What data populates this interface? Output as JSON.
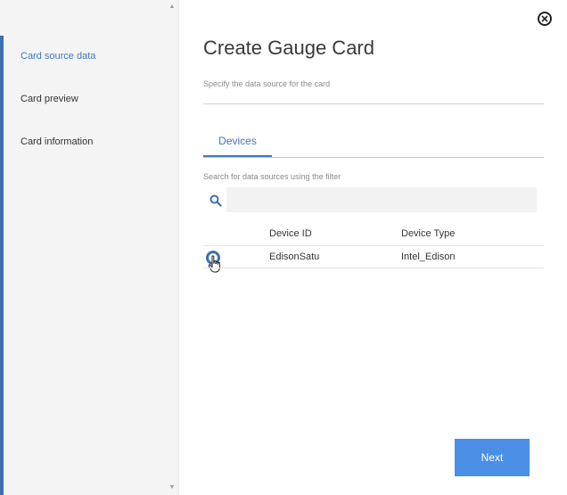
{
  "sidebar": {
    "items": [
      {
        "label": "Card source data",
        "active": true
      },
      {
        "label": "Card preview",
        "active": false
      },
      {
        "label": "Card information",
        "active": false
      }
    ]
  },
  "dialog": {
    "title": "Create Gauge Card",
    "subtitle": "Specify the data source for the card",
    "close_icon": "close-circle-icon"
  },
  "tabs": [
    {
      "label": "Devices",
      "active": true
    }
  ],
  "filter": {
    "hint": "Search for data sources using the filter",
    "search_icon": "search-icon",
    "value": "",
    "placeholder": ""
  },
  "table": {
    "columns": [
      "Device ID",
      "Device Type"
    ],
    "rows": [
      {
        "device_id": "EdisonSatu",
        "device_type": "Intel_Edison",
        "selected": false
      }
    ]
  },
  "footer": {
    "next_label": "Next"
  },
  "colors": {
    "accent": "#4178be",
    "primary_button": "#4a8ee6",
    "sidebar_bg": "#f4f4f4"
  }
}
